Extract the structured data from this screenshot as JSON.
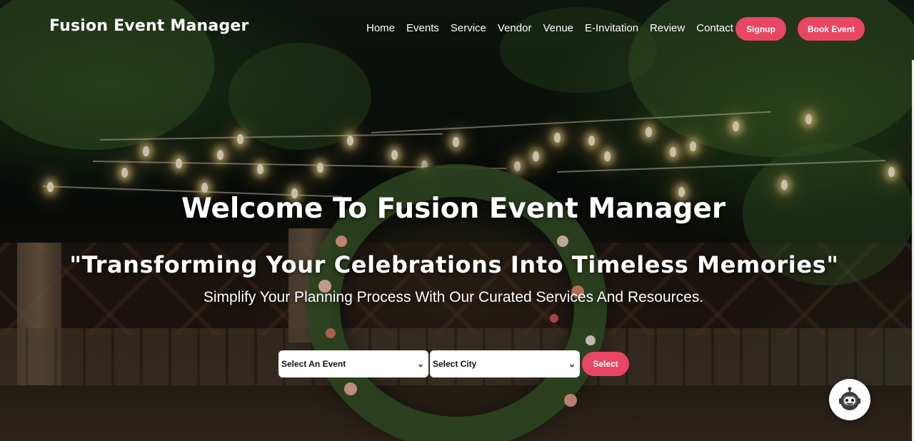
{
  "brand": {
    "name": "Fusion Event Manager"
  },
  "nav": {
    "links": [
      "Home",
      "Events",
      "Service",
      "Vendor",
      "Venue",
      "E-Invitation",
      "Review",
      "Contact"
    ],
    "signup_label": "Signup",
    "book_label": "Book Event"
  },
  "hero": {
    "title": "Welcome To Fusion Event Manager",
    "subtitle": "\"Transforming Your Celebrations Into Timeless Memories\"",
    "tagline": "Simplify Your Planning Process With Our Curated Services And Resources."
  },
  "search": {
    "event_select": "Select An Event",
    "city_select": "Select City",
    "submit_label": "Select"
  },
  "chatbot": {
    "icon": "robot-icon"
  },
  "colors": {
    "accent": "#e84663",
    "text": "#ffffff"
  }
}
